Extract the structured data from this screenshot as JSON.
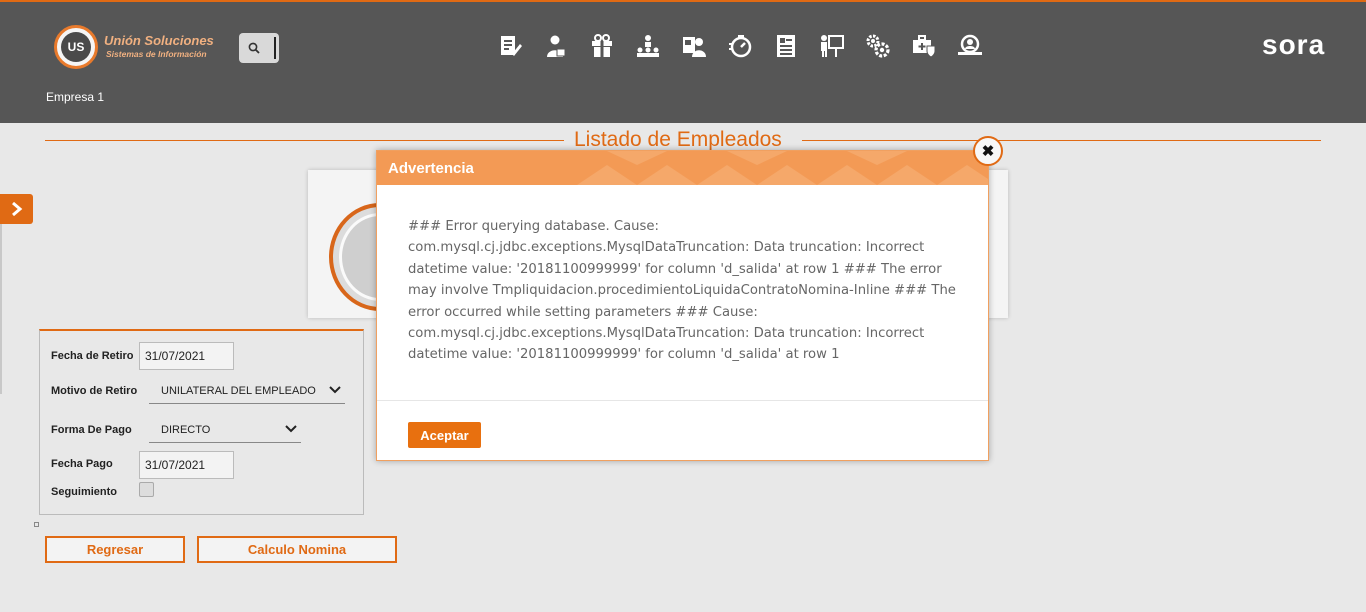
{
  "header": {
    "brand_name": "Unión Soluciones",
    "brand_sub": "Sistemas de Información",
    "logo_text": "US",
    "app_name": "sora",
    "company": "Empresa 1",
    "nav_icons": [
      "contract-edit-icon",
      "employee-icon",
      "gift-icon",
      "org-chart-icon",
      "id-card-user-icon",
      "timer-icon",
      "document-list-icon",
      "presentation-icon",
      "gears-icon",
      "medical-kit-icon",
      "search-user-icon"
    ]
  },
  "page": {
    "title": "Listado de Empleados"
  },
  "form": {
    "fecha_retiro_label": "Fecha de Retiro",
    "fecha_retiro_value": "31/07/2021",
    "motivo_label": "Motivo de Retiro",
    "motivo_value": "UNILATERAL DEL EMPLEADO",
    "forma_pago_label": "Forma De Pago",
    "forma_pago_value": "DIRECTO",
    "fecha_pago_label": "Fecha Pago",
    "fecha_pago_value": "31/07/2021",
    "seguimiento_label": "Seguimiento"
  },
  "actions": {
    "back_label": "Regresar",
    "calc_label": "Calculo Nomina"
  },
  "modal": {
    "title": "Advertencia",
    "message": "### Error querying database. Cause: com.mysql.cj.jdbc.exceptions.MysqlDataTruncation: Data truncation: Incorrect datetime value: '20181100999999' for column 'd_salida' at row 1 ### The error may involve Tmpliquidacion.procedimientoLiquidaContratoNomina-Inline ### The error occurred while setting parameters ### Cause: com.mysql.cj.jdbc.exceptions.MysqlDataTruncation: Data truncation: Incorrect datetime value: '20181100999999' for column 'd_salida' at row 1",
    "accept_label": "Aceptar",
    "close_symbol": "✖"
  },
  "colors": {
    "accent": "#e06a14",
    "header_bg": "#565656",
    "modal_header": "#f39a55"
  }
}
